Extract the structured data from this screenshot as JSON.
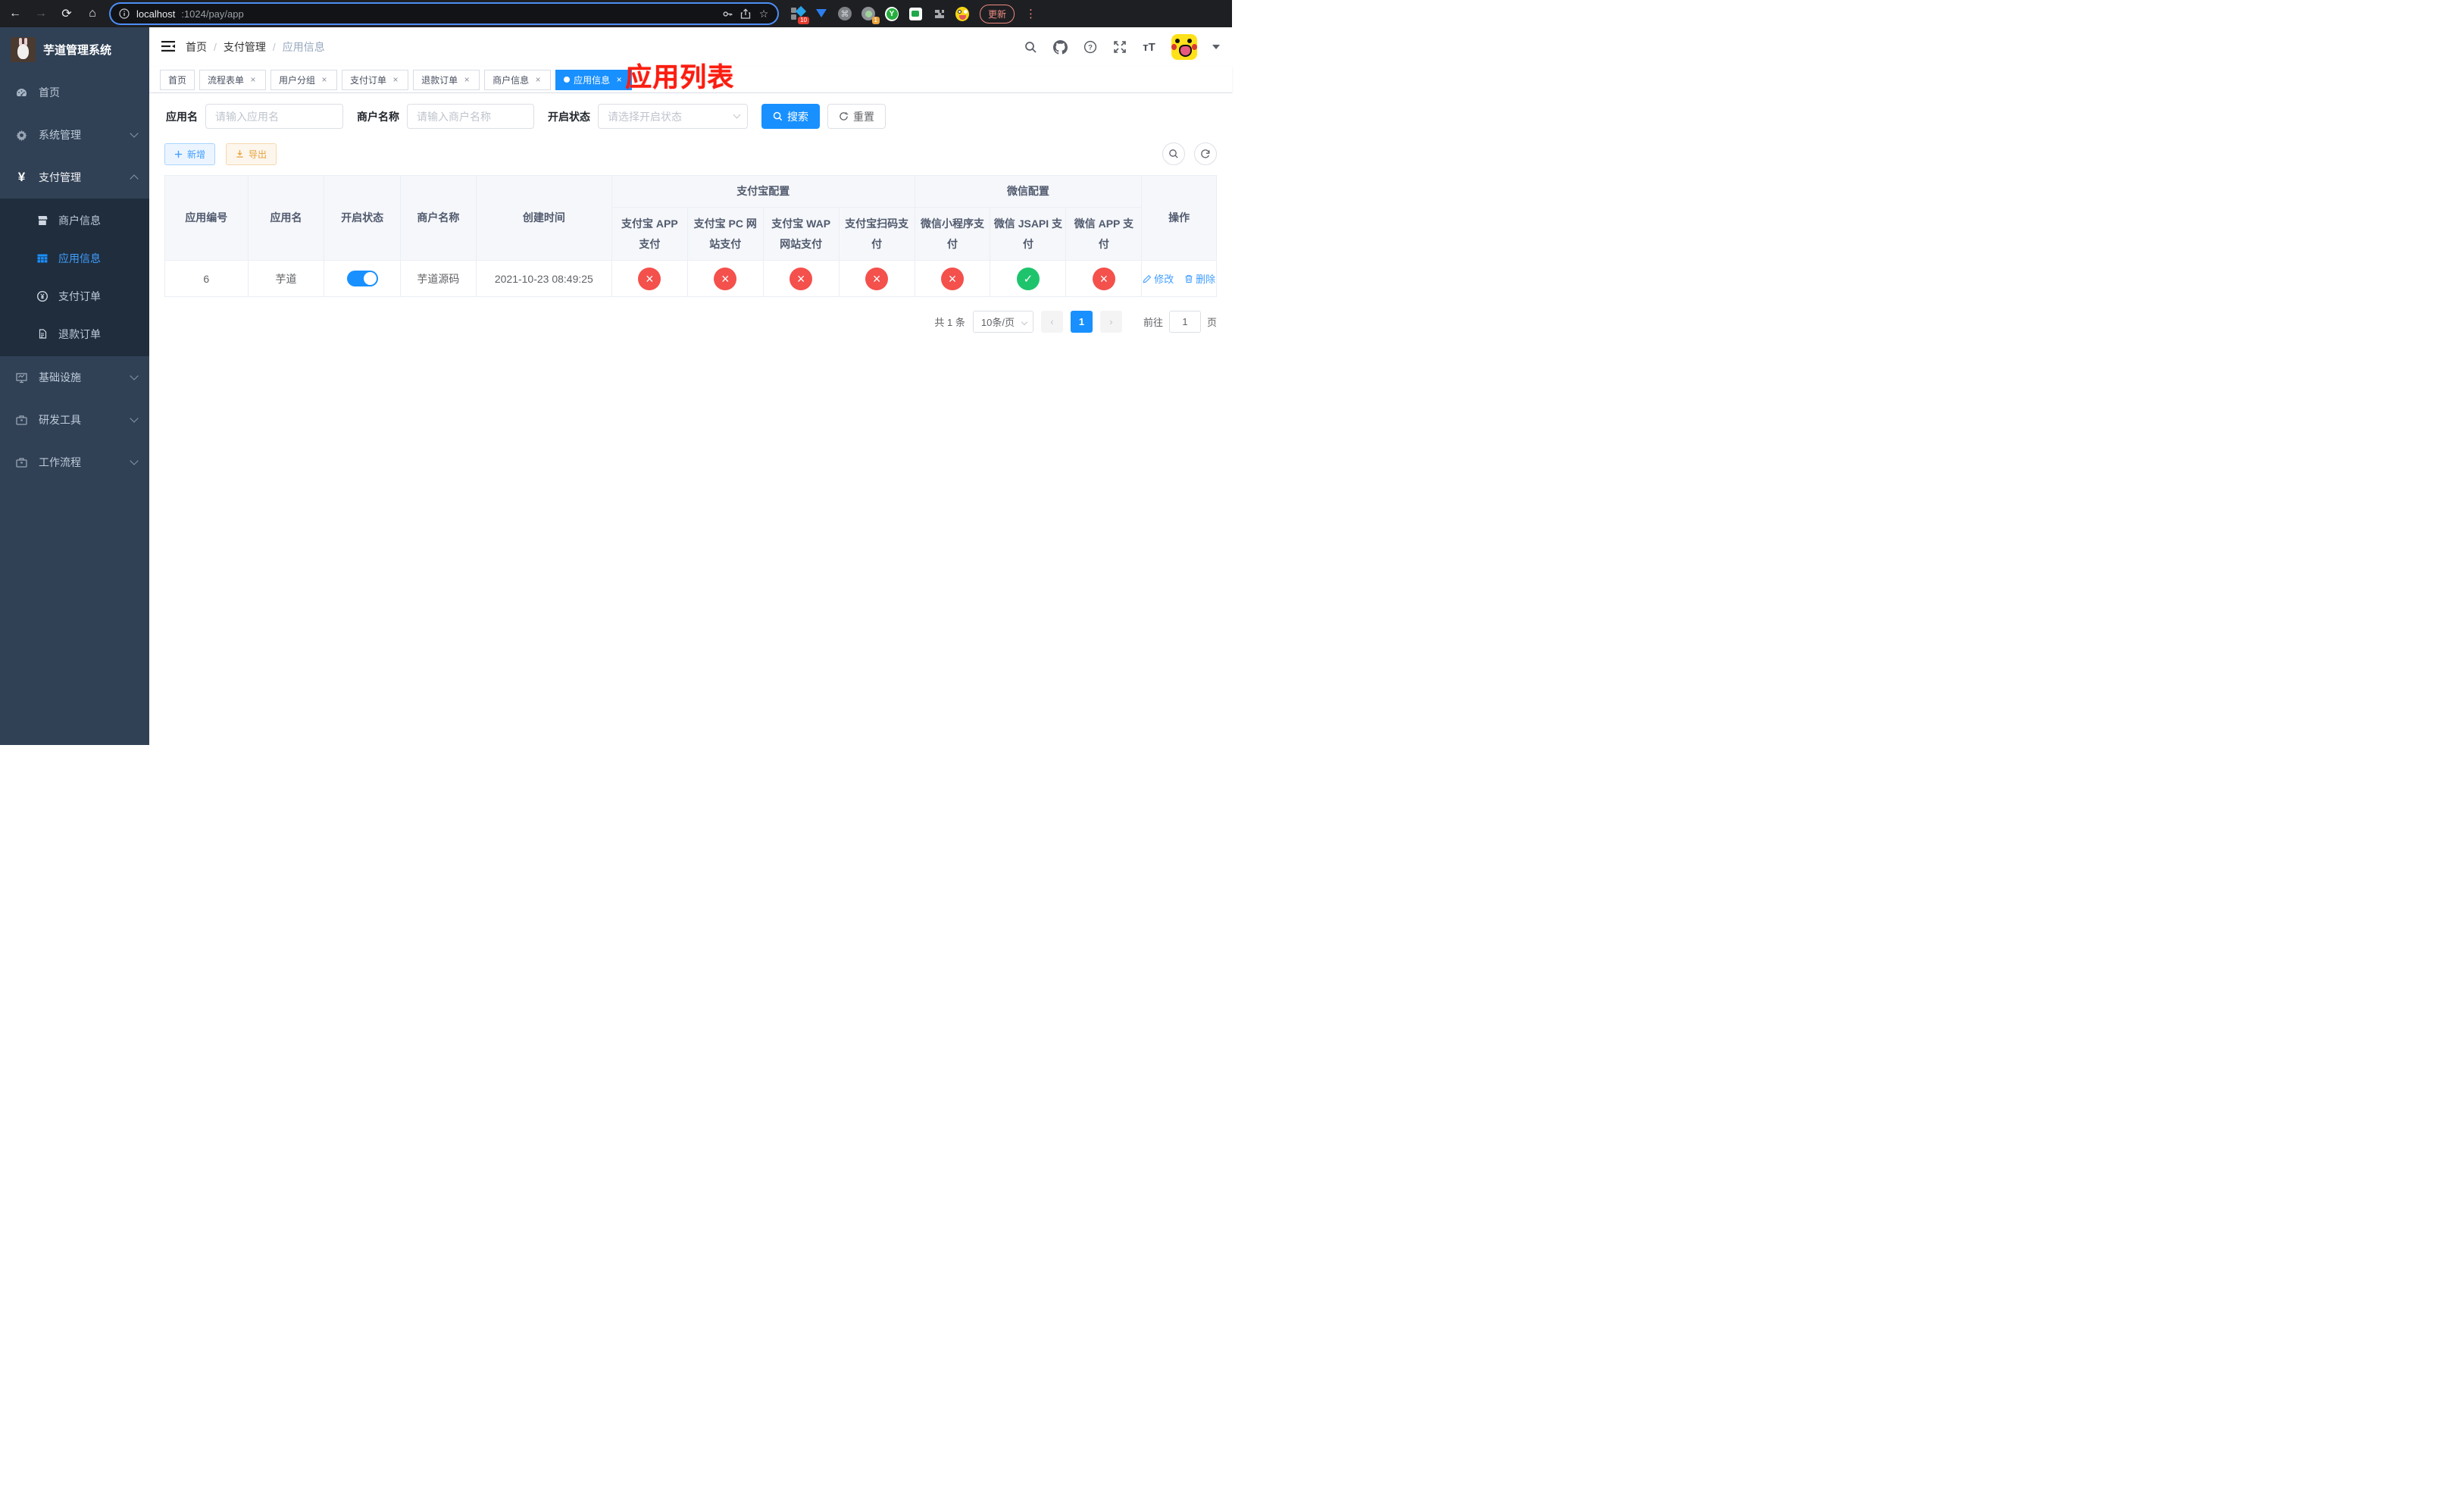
{
  "browser": {
    "url_host": "localhost",
    "url_rest": ":1024/pay/app",
    "ext_badge_apps": "10",
    "ext_badge_proxy": "1",
    "y_letter": "Y",
    "update_label": "更新"
  },
  "icons": {
    "back": "←",
    "forward": "→",
    "reload": "⟳",
    "home": "⌂",
    "star": "☆",
    "command": "⌘",
    "more_vertical": "⋮",
    "text_size": "тT",
    "prev": "‹",
    "next": "›",
    "close": "×",
    "check": "✓",
    "cross": "×"
  },
  "sidebar": {
    "title": "芋道管理系统",
    "menu": [
      {
        "label": "首页"
      },
      {
        "label": "系统管理"
      },
      {
        "label": "支付管理"
      }
    ],
    "submenu": [
      {
        "label": "商户信息"
      },
      {
        "label": "应用信息"
      },
      {
        "label": "支付订单"
      },
      {
        "label": "退款订单"
      }
    ],
    "menu2": [
      {
        "label": "基础设施"
      },
      {
        "label": "研发工具"
      },
      {
        "label": "工作流程"
      }
    ]
  },
  "header": {
    "breadcrumb": [
      "首页",
      "支付管理",
      "应用信息"
    ],
    "overlay_title": "应用列表"
  },
  "tabs": [
    {
      "label": "首页"
    },
    {
      "label": "流程表单"
    },
    {
      "label": "用户分组"
    },
    {
      "label": "支付订单"
    },
    {
      "label": "退款订单"
    },
    {
      "label": "商户信息"
    },
    {
      "label": "应用信息"
    }
  ],
  "filters": {
    "app_name_label": "应用名",
    "app_name_placeholder": "请输入应用名",
    "merchant_label": "商户名称",
    "merchant_placeholder": "请输入商户名称",
    "status_label": "开启状态",
    "status_placeholder": "请选择开启状态",
    "search_label": "搜索",
    "reset_label": "重置"
  },
  "toolbar": {
    "add_label": "新增",
    "export_label": "导出"
  },
  "table": {
    "groups": {
      "alipay": "支付宝配置",
      "wechat": "微信配置"
    },
    "columns": [
      "应用编号",
      "应用名",
      "开启状态",
      "商户名称",
      "创建时间"
    ],
    "channel_columns": [
      "支付宝 APP 支付",
      "支付宝 PC 网站支付",
      "支付宝 WAP 网站支付",
      "支付宝扫码支付",
      "微信小程序支付",
      "微信 JSAPI 支付",
      "微信 APP 支付"
    ],
    "ops_column": "操作",
    "row": {
      "id": "6",
      "name": "芋道",
      "enabled": true,
      "merchant": "芋道源码",
      "created": "2021-10-23 08:49:25",
      "channels": [
        false,
        false,
        false,
        false,
        false,
        true,
        false
      ],
      "ops": [
        "修改",
        "删除"
      ]
    }
  },
  "pagination": {
    "total": "共 1 条",
    "page_size": "10条/页",
    "current": "1",
    "goto_label": "前往",
    "goto_value": "1",
    "page_label": "页"
  }
}
